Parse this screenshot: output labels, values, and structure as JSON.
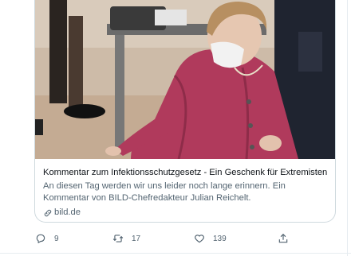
{
  "card": {
    "title": "Kommentar zum Infektionsschutzgesetz - Ein Geschenk für Extremisten",
    "description": "An diesen Tag werden wir uns leider noch lange erinnern. Ein Kommentar von BILD-Chefredakteur Julian Reichelt.",
    "domain": "bild.de"
  },
  "actions": {
    "replies": "9",
    "retweets": "17",
    "likes": "139"
  },
  "icons": {
    "reply": "speech-bubble-icon",
    "retweet": "retweet-arrows-icon",
    "like": "heart-icon",
    "share": "share-upload-icon",
    "link": "link-chain-icon"
  },
  "colors": {
    "title": "#0f1419",
    "secondary": "#536471",
    "border": "#cfd9de"
  }
}
